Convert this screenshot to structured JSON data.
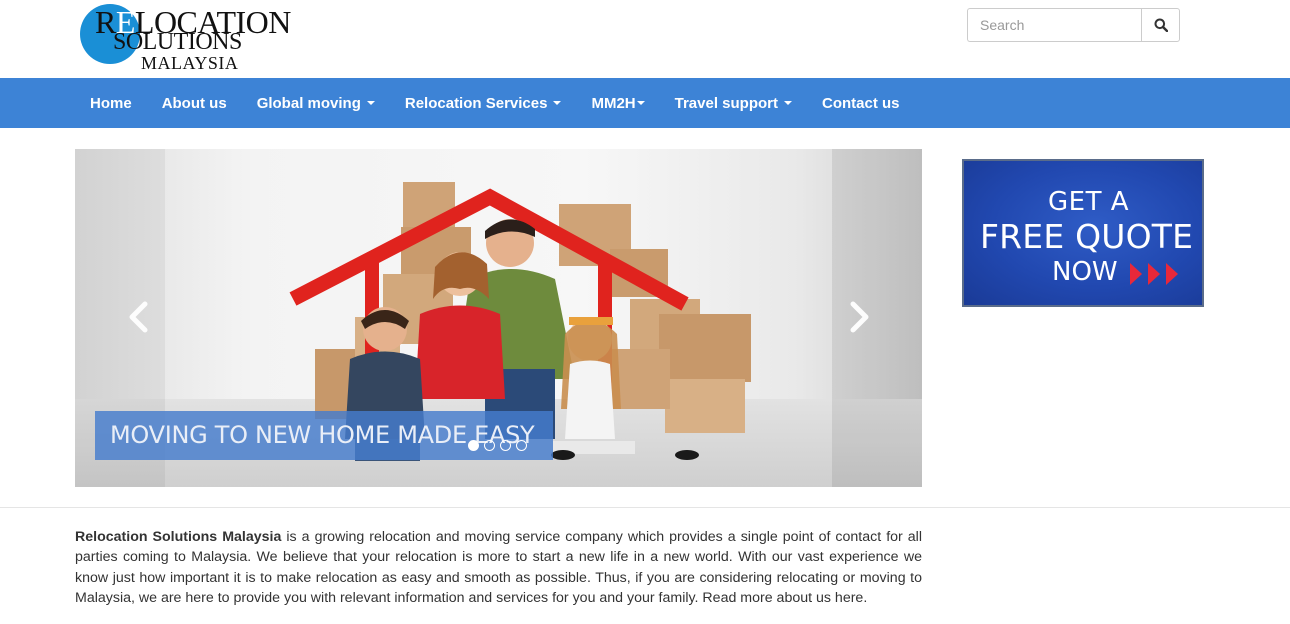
{
  "logo": {
    "line1_prefix": "R",
    "line1_accent": "E",
    "line1_rest": "LOCATION",
    "line2": "SOLUTIONS",
    "line3": "MALAYSIA"
  },
  "search": {
    "placeholder": "Search",
    "icon": "search-icon"
  },
  "nav": {
    "items": [
      {
        "label": "Home",
        "dropdown": false
      },
      {
        "label": "About us",
        "dropdown": false
      },
      {
        "label": "Global moving",
        "dropdown": true
      },
      {
        "label": "Relocation Services",
        "dropdown": true
      },
      {
        "label": "MM2H",
        "dropdown": true
      },
      {
        "label": "Travel support",
        "dropdown": true
      },
      {
        "label": "Contact us",
        "dropdown": false
      }
    ]
  },
  "carousel": {
    "caption": "MOVING TO NEW HOME MADE EASY",
    "slide_count": 4,
    "active_slide": 1,
    "prev_icon": "chevron-left-icon",
    "next_icon": "chevron-right-icon"
  },
  "quote_banner": {
    "line1": "GET A",
    "line2": "FREE QUOTE",
    "line3": "NOW",
    "arrow_color": "#e8283a"
  },
  "intro": {
    "company": "Relocation Solutions Malaysia",
    "body": " is a growing relocation and moving service company which provides a single point of contact for all parties coming to Malaysia. We believe that your relocation is more to start a new life in a new world. With our vast experience we know just how important it is to make relocation as easy and smooth as possible. Thus, if you are considering relocating or moving to Malaysia, we are here to provide you with relevant information and services for you and your family. Read more about us here."
  },
  "colors": {
    "navbar": "#3d83d6",
    "logo_circle": "#1a8fd6",
    "quote_bg": "#2148b0"
  }
}
